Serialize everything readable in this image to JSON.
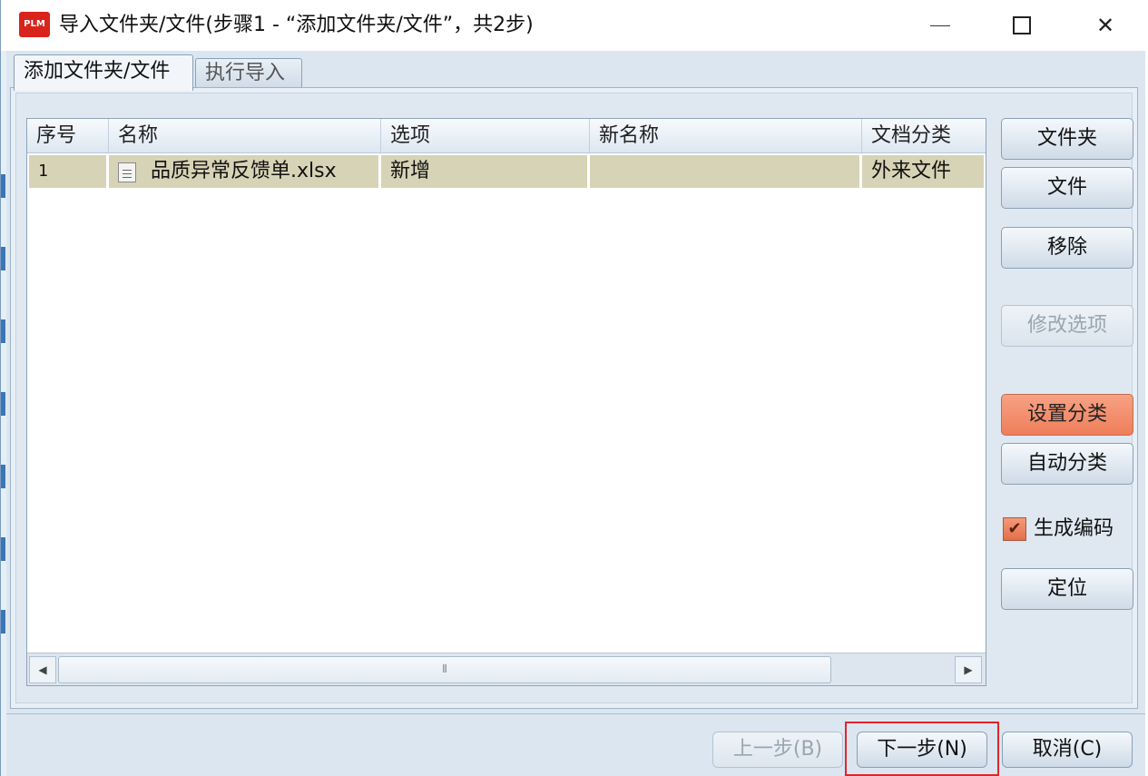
{
  "window": {
    "app_icon_text": "PLM",
    "title": "导入文件夹/文件(步骤1 - “添加文件夹/文件”，共2步)",
    "minimize_icon": "minimize-icon",
    "maximize_icon": "maximize-icon",
    "close_icon": "close-icon",
    "close_glyph": "✕"
  },
  "tabs": [
    {
      "label": "添加文件夹/文件",
      "active": true
    },
    {
      "label": "执行导入",
      "active": false
    }
  ],
  "table": {
    "columns": [
      "序号",
      "名称",
      "选项",
      "新名称",
      "文档分类"
    ],
    "rows": [
      {
        "index": "1",
        "name": "品质异常反馈单.xlsx",
        "option": "新增",
        "new_name": "",
        "category": "外来文件",
        "icon": "file-icon"
      }
    ],
    "row_highlight_color": "#d6d3b6"
  },
  "scrollbar": {
    "left_arrow": "◀",
    "right_arrow": "▶",
    "thumb_grip": "⦀"
  },
  "side_buttons": {
    "folder": "文件夹",
    "file": "文件",
    "remove": "移除",
    "modify_options": "修改选项",
    "set_category": "设置分类",
    "auto_category": "自动分类",
    "locate": "定位"
  },
  "generate_code": {
    "label": "生成编码",
    "checked": true,
    "check_glyph": "✔"
  },
  "bottom_buttons": {
    "prev": "上一步(B)",
    "next": "下一步(N)",
    "cancel": "取消(C)"
  },
  "colors": {
    "accent_orange": "#ef7e5a",
    "focus_red": "#e0262a",
    "panel_blue": "#dce6f0"
  }
}
